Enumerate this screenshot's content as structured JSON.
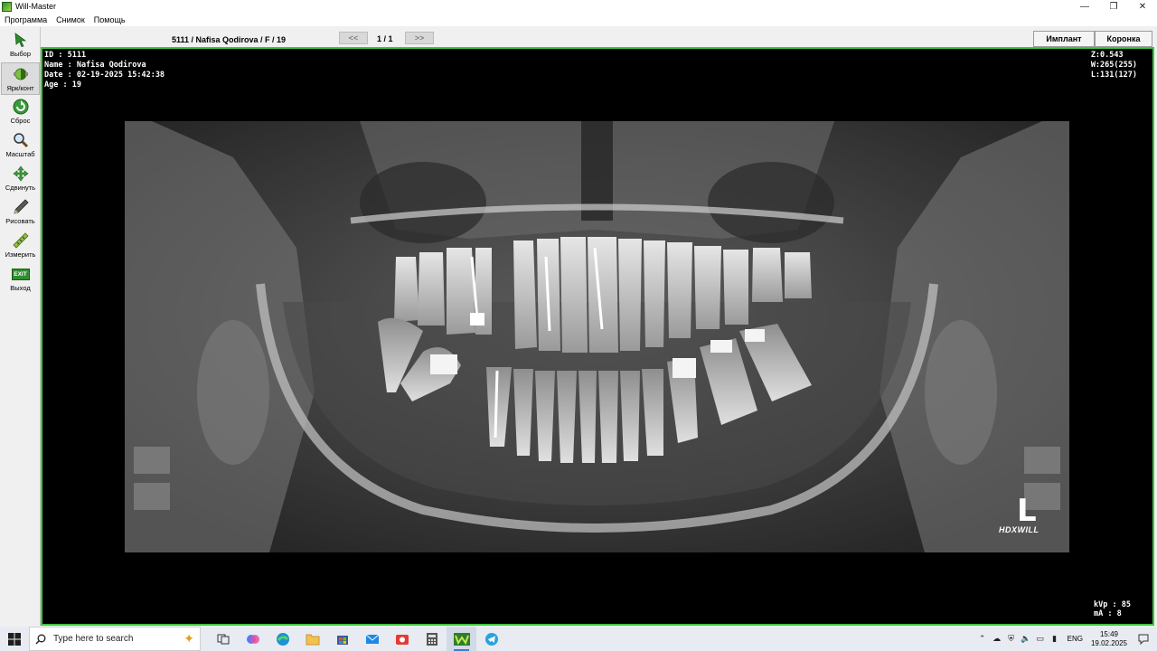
{
  "window": {
    "title": "Will-Master",
    "controls": [
      "—",
      "❐",
      "✕"
    ]
  },
  "menu": {
    "items": [
      "Программа",
      "Снимок",
      "Помощь"
    ]
  },
  "toolbar": {
    "tools": [
      {
        "label": "Выбор",
        "icon": "pointer-arrow-icon"
      },
      {
        "label": "Ярк/конт",
        "icon": "brightness-contrast-icon"
      },
      {
        "label": "Сброс",
        "icon": "reset-icon"
      },
      {
        "label": "Масштаб",
        "icon": "zoom-magnifier-icon"
      },
      {
        "label": "Сдвинуть",
        "icon": "move-arrows-icon"
      },
      {
        "label": "Рисовать",
        "icon": "pencil-icon"
      },
      {
        "label": "Измерить",
        "icon": "ruler-icon"
      },
      {
        "label": "Выход",
        "icon": "exit-icon",
        "icon_text": "EXIT"
      }
    ],
    "active_tool": "Ярк/конт"
  },
  "header": {
    "patient_line": "5111 / Nafisa Qodirova / F / 19",
    "prev_label": "<<",
    "page_indicator": "1 / 1",
    "next_label": ">>",
    "implant_label": "Имплант",
    "crown_label": "Коронка"
  },
  "viewer": {
    "info": {
      "id": "ID : 5111",
      "name": "Name : Nafisa Qodirova",
      "date": "Date : 02-19-2025 15:42:38",
      "age": "Age : 19"
    },
    "display": {
      "zoom": "Z:0.543",
      "window": "W:265(255)",
      "level": "L:131(127)"
    },
    "exposure": {
      "kvp": "kVp : 85",
      "ma": "mA : 8"
    },
    "side_marker": "L",
    "brand": "HDXWILL",
    "border_color": "#3cc93c"
  },
  "taskbar": {
    "search_placeholder": "Type here to search",
    "apps": [
      "task-view-icon",
      "copilot-icon",
      "edge-icon",
      "file-explorer-icon",
      "store-icon",
      "mail-icon",
      "camera-app-icon",
      "calculator-icon",
      "will-master-icon",
      "telegram-icon"
    ],
    "active_app": "will-master-icon",
    "language": "ENG",
    "time": "15:49",
    "date": "19.02.2025"
  }
}
